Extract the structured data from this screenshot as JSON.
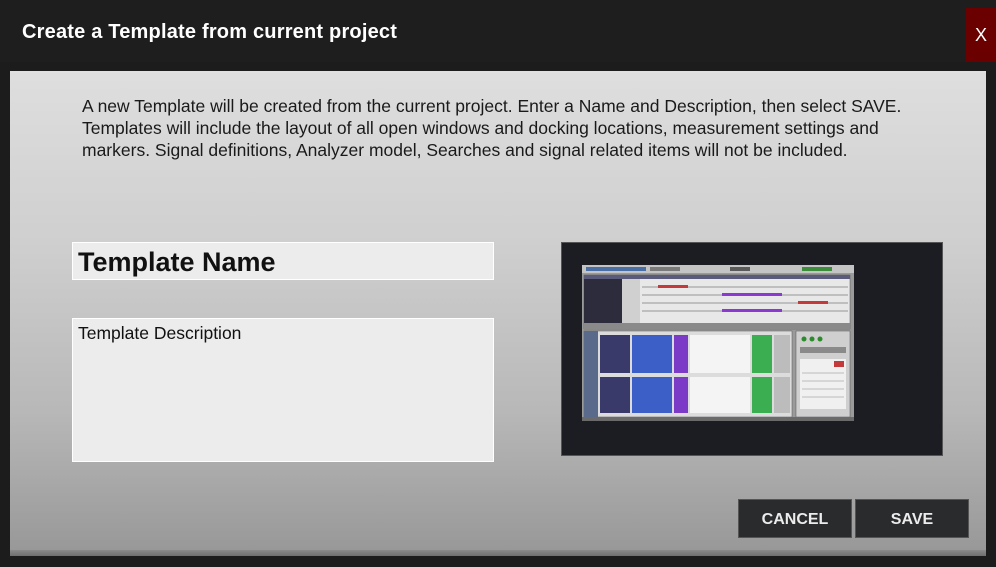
{
  "window": {
    "title": "Create a Template from current project",
    "close_label": "X"
  },
  "intro_text": "A new Template will be created from the current project. Enter a Name and Description, then select SAVE. Templates will include the layout of all open windows and docking locations, measurement settings and markers. Signal definitions, Analyzer model, Searches and signal related items will not be included.",
  "form": {
    "name_value": "Template Name",
    "description_value": "Template Description"
  },
  "buttons": {
    "cancel_label": "CANCEL",
    "save_label": "SAVE"
  },
  "colors": {
    "titlebar": "#1e1e1e",
    "close_button": "#6a0000",
    "button_bg": "#2a2b2d",
    "preview_bg": "#1c1d22"
  }
}
